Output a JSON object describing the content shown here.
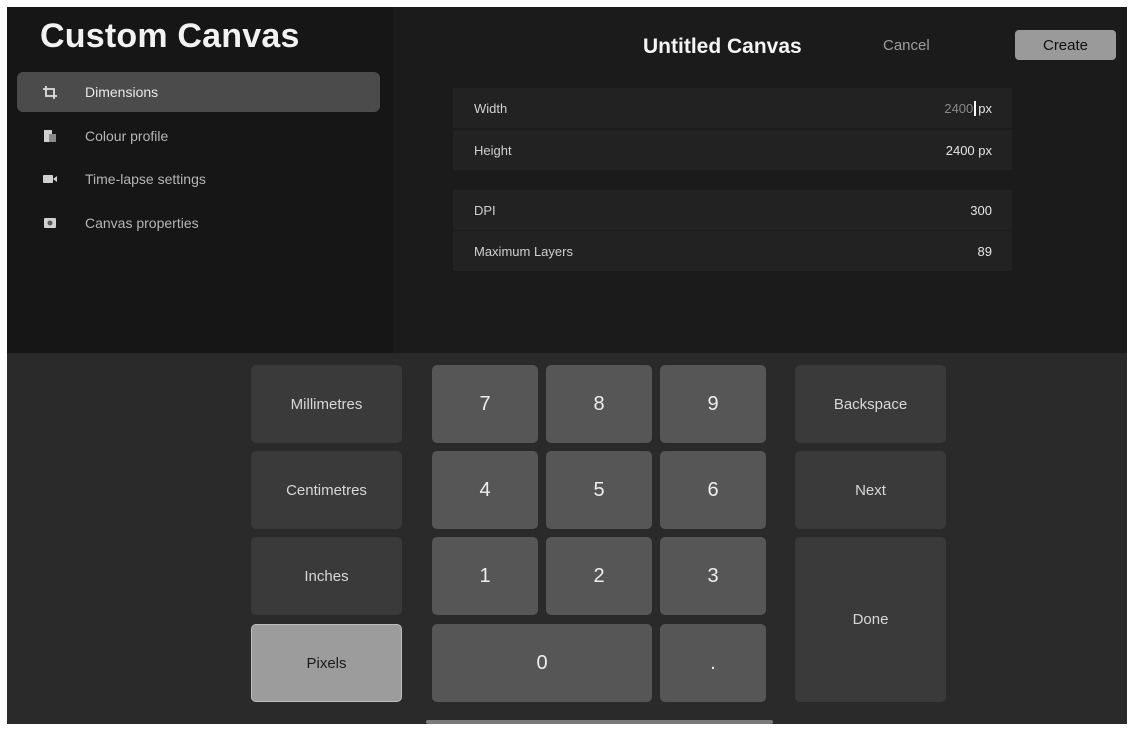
{
  "app_title": "Custom Canvas",
  "header": {
    "canvas_name": "Untitled Canvas",
    "cancel_label": "Cancel",
    "create_label": "Create"
  },
  "sidebar": {
    "items": [
      {
        "label": "Dimensions",
        "icon": "dimensions-icon",
        "active": true
      },
      {
        "label": "Colour profile",
        "icon": "colour-profile-icon",
        "active": false
      },
      {
        "label": "Time-lapse settings",
        "icon": "video-camera-icon",
        "active": false
      },
      {
        "label": "Canvas properties",
        "icon": "canvas-properties-icon",
        "active": false
      }
    ]
  },
  "fields": {
    "width": {
      "label": "Width",
      "value": "2400",
      "unit": "px"
    },
    "height": {
      "label": "Height",
      "value": "2400 px"
    },
    "dpi": {
      "label": "DPI",
      "value": "300"
    },
    "max_layers": {
      "label": "Maximum Layers",
      "value": "89"
    }
  },
  "keypad": {
    "units": [
      "Millimetres",
      "Centimetres",
      "Inches",
      "Pixels"
    ],
    "selected_unit": "Pixels",
    "digits": [
      "7",
      "8",
      "9",
      "4",
      "5",
      "6",
      "1",
      "2",
      "3",
      "0",
      "."
    ],
    "backspace_label": "Backspace",
    "next_label": "Next",
    "done_label": "Done"
  },
  "colors": {
    "background": "#1b1b1b",
    "sidebar_active": "#4b4b4b",
    "create_button": "#9a9a9a",
    "number_key": "#565656",
    "selected_unit": "#9c9c9c"
  }
}
